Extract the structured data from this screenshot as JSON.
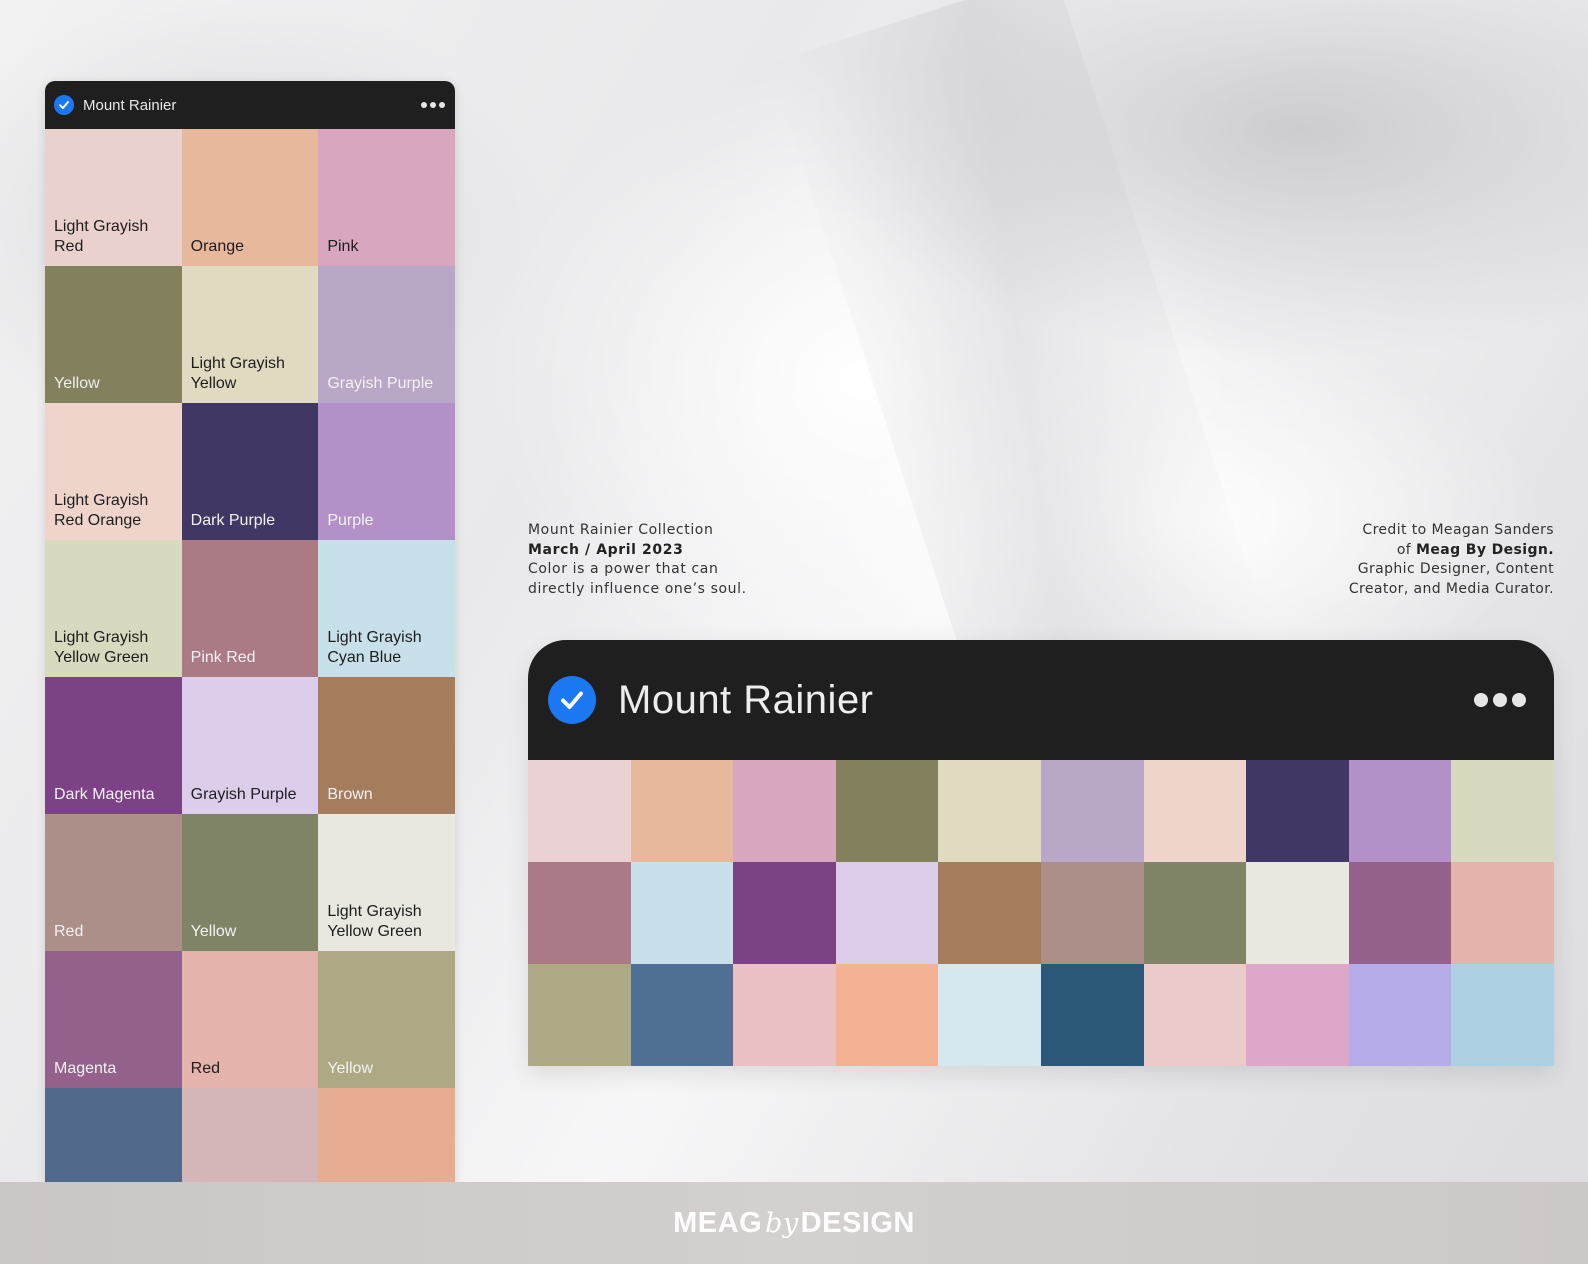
{
  "palette_name": "Mount Rainier",
  "vertical_panel": {
    "swatches": [
      {
        "label": "Light Grayish\nRed",
        "color": "#ebd1cd",
        "text": "#1d1d1d"
      },
      {
        "label": "Orange",
        "color": "#e8b89c",
        "text": "#1d1d1d"
      },
      {
        "label": "Pink",
        "color": "#d9a6bf",
        "text": "#1d1d1d"
      },
      {
        "label": "Yellow",
        "color": "#82805d",
        "text": "#eeeeee"
      },
      {
        "label": "Light Grayish\nYellow",
        "color": "#e0dac0",
        "text": "#1d1d1d"
      },
      {
        "label": "Grayish Purple",
        "color": "#b8a7c7",
        "text": "#f2f2f2"
      },
      {
        "label": "Light Grayish\nRed Orange",
        "color": "#efd4cc",
        "text": "#1d1d1d"
      },
      {
        "label": "Dark Purple",
        "color": "#413764",
        "text": "#f2f2f2"
      },
      {
        "label": "Purple",
        "color": "#b391c8",
        "text": "#f2f2f2"
      },
      {
        "label": "Light Grayish\nYellow Green",
        "color": "#d8dac0",
        "text": "#1d1d1d"
      },
      {
        "label": "Pink Red",
        "color": "#ac7a85",
        "text": "#f2f2f2"
      },
      {
        "label": "Light Grayish\nCyan Blue",
        "color": "#c8e0ea",
        "text": "#1d1d1d"
      },
      {
        "label": "Dark Magenta",
        "color": "#7c4285",
        "text": "#f2f2f2"
      },
      {
        "label": "Grayish Purple",
        "color": "#dccdeb",
        "text": "#1d1d1d"
      },
      {
        "label": "Brown",
        "color": "#a57c5c",
        "text": "#f2f2f2"
      },
      {
        "label": "Red",
        "color": "#ad8f8a",
        "text": "#f2f2f2"
      },
      {
        "label": "Yellow",
        "color": "#7f8466",
        "text": "#f2f2f2"
      },
      {
        "label": "Light Grayish\nYellow Green",
        "color": "#e8e8e1",
        "text": "#1d1d1d"
      },
      {
        "label": "Magenta",
        "color": "#94618c",
        "text": "#f2f2f2"
      },
      {
        "label": "Red",
        "color": "#e4b3ab",
        "text": "#1d1d1d"
      },
      {
        "label": "Yellow",
        "color": "#aea985",
        "text": "#f2f2f2"
      },
      {
        "label": "",
        "color": "#51698a",
        "text": "#f2f2f2"
      },
      {
        "label": "",
        "color": "#d5b6b8",
        "text": "#1d1d1d"
      },
      {
        "label": "",
        "color": "#e7ad93",
        "text": "#1d1d1d"
      }
    ]
  },
  "info_left": {
    "line1": "Mount Rainier Collection",
    "line2": "March / April 2023",
    "line3": "Color is a power that can",
    "line4": "directly influence one’s soul."
  },
  "info_right": {
    "line1": "Credit to Meagan Sanders",
    "line2_prefix": "of ",
    "line2_bold": "Meag By Design.",
    "line3": "Graphic Designer, Content",
    "line4": "Creator, and Media Curator."
  },
  "horizontal_panel": {
    "swatches": [
      "#ebd1d3",
      "#e8b89c",
      "#d9a6c0",
      "#82805d",
      "#e0dac0",
      "#b8a7c7",
      "#efd4cc",
      "#413764",
      "#b391c8",
      "#d8dac0",
      "#ac7a87",
      "#c8e0ea",
      "#7c4285",
      "#dccdeb",
      "#a57c5c",
      "#ad8f8a",
      "#7f8466",
      "#e8e8e1",
      "#94618c",
      "#e4b3ab",
      "#aea985",
      "#4f6f95",
      "#eac0c2",
      "#f4b193",
      "#d7e7f0",
      "#2b5879",
      "#ebcaca",
      "#dea6c9",
      "#b6acea",
      "#add0e3"
    ]
  },
  "footer": {
    "brand_left": "MEAG",
    "brand_mid": "by",
    "brand_right": "DESIGN"
  }
}
